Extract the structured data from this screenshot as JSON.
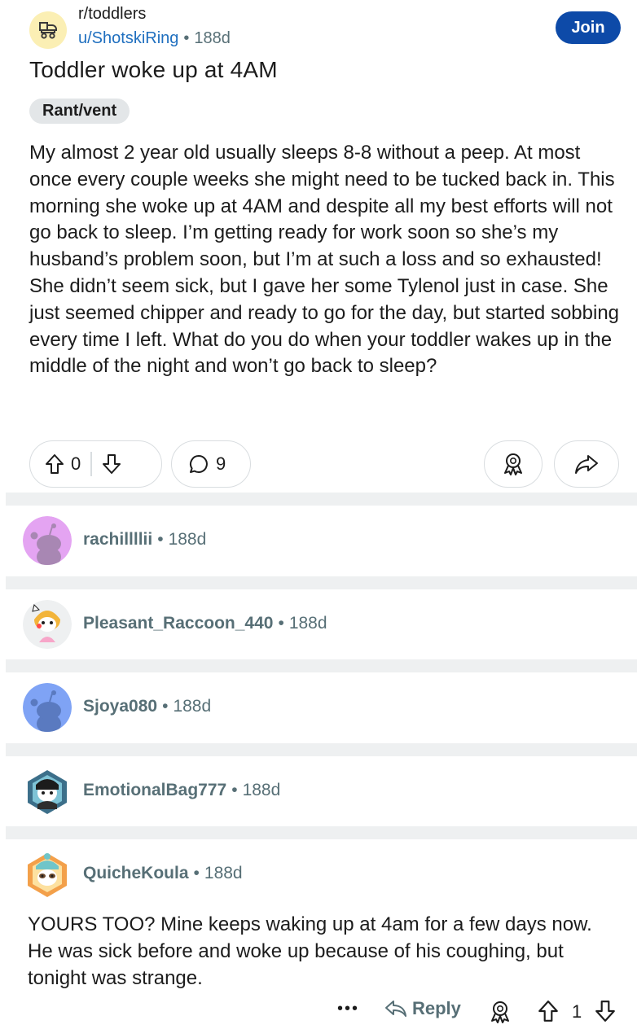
{
  "post": {
    "subreddit": "r/toddlers",
    "author": "u/ShotskiRing",
    "separator": "•",
    "age": "188d",
    "join_label": "Join",
    "title": "Toddler woke up at 4AM",
    "flair": "Rant/vent",
    "body": "My almost 2 year old usually sleeps 8-8 without a peep. At most once every couple weeks she might need to be tucked back in. This morning she woke up at 4AM and despite all my best efforts will not go back to sleep. I’m getting ready for work soon so she’s my husband’s problem soon, but I’m at such a loss and so exhausted! She didn’t seem sick, but I gave her some Tylenol just in case. She just seemed chipper and ready to go for the day, but started sobbing every time I left. What do you do when your toddler wakes up in the middle of the night and won’t go back to sleep?",
    "vote_count": "0",
    "comment_count": "9"
  },
  "comments": [
    {
      "user": "rachillllii",
      "age": "188d",
      "avatar_color": "#e4a4f2"
    },
    {
      "user": "Pleasant_Raccoon_440",
      "age": "188d",
      "avatar_color": "#f2b43a"
    },
    {
      "user": "Sjoya080",
      "age": "188d",
      "avatar_color": "#7fa3f5"
    },
    {
      "user": "EmotionalBag777",
      "age": "188d",
      "avatar_color": "#3c6f8a"
    },
    {
      "user": "QuicheKoula",
      "age": "188d",
      "avatar_color": "#f3a04a"
    }
  ],
  "last_comment": {
    "body": "YOURS TOO? Mine keeps waking up at 4am for a few days now. He was sick before and woke up because of his coughing, but tonight was strange.",
    "more_label": "•••",
    "reply_label": "Reply",
    "vote_count": "1"
  },
  "icons": {
    "sub": "stroller-icon",
    "upvote": "arrow-up-icon",
    "downvote": "arrow-down-icon",
    "comment": "speech-bubble-icon",
    "award": "award-icon",
    "share": "share-arrow-icon",
    "reply": "reply-arrow-icon"
  }
}
